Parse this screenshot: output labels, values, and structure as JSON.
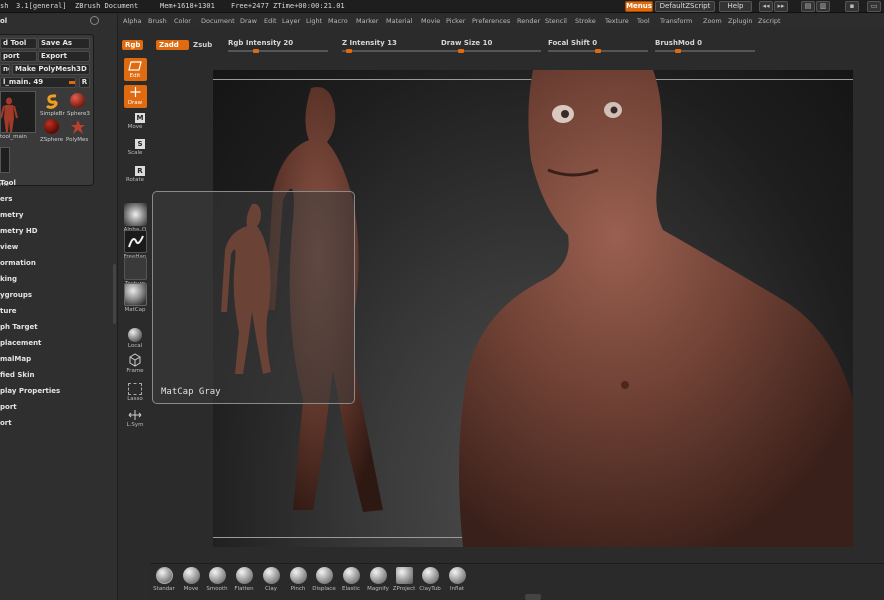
{
  "titlebar": {
    "app": "sh",
    "version": "3.1[general]",
    "document": "ZBrush Document",
    "mem": "Mem+1618+1301",
    "free": "Free+2477",
    "ztime": "ZTime+00:00:21.01",
    "menus_button": "Menus",
    "script_button": "DefaultZScript",
    "help_button": "Help"
  },
  "menubar": [
    "Alpha",
    "Brush",
    "Color",
    "Document",
    "Draw",
    "Edit",
    "Layer",
    "Light",
    "Macro",
    "Marker",
    "Material",
    "Movie",
    "Picker",
    "Preferences",
    "Render",
    "Stencil",
    "Stroke",
    "Texture",
    "Tool",
    "Transform",
    "Zoom",
    "Zplugin",
    "Zscript"
  ],
  "topshelf": {
    "rgb": "Rgb",
    "zadd": "Zadd",
    "zsub": "Zsub",
    "rgb_intensity": "Rgb Intensity 20",
    "z_intensity": "Z Intensity 13",
    "draw_size": "Draw Size 10",
    "focal_shift": "Focal Shift 0",
    "brush_mod": "BrushMod 0"
  },
  "leftpanel": {
    "title": "ol",
    "load_tool": "d Tool",
    "save_as": "Save As",
    "import": "port",
    "export": "Export",
    "clone": "ne",
    "make_polymesh": "Make PolyMesh3D",
    "slider_label": "l_main. 49",
    "r_button": "R",
    "current_tool_label": "tool_main",
    "simple_brush_label": "SimpleBr",
    "sphere3d_label": "Sphere3",
    "zsphere_label": "ZSphere",
    "polymesh_label": "PolyMes",
    "extra_label": "me",
    "menu_items": [
      "Tool",
      "ers",
      "metry",
      "metry HD",
      "view",
      "ormation",
      "king",
      "ygroups",
      "ture",
      "ph Target",
      "placement",
      "malMap",
      "fied Skin",
      "play Properties",
      "port",
      "ort"
    ]
  },
  "toolstrip": [
    {
      "label": "Edit"
    },
    {
      "label": "Draw"
    },
    {
      "label": "Move",
      "key": "M"
    },
    {
      "label": "Scale",
      "key": "S"
    },
    {
      "label": "Rotate",
      "key": "R"
    },
    {
      "label": "Alpha_O"
    },
    {
      "label": "FreeHan"
    },
    {
      "label": "Texture"
    },
    {
      "label": "MatCap"
    },
    {
      "label": "Local"
    },
    {
      "label": "Frame"
    },
    {
      "label": "Lasso"
    },
    {
      "label": "L.Sym"
    }
  ],
  "matcap_popup": {
    "caption": "MatCap Gray"
  },
  "bottomshelf": [
    "Standar",
    "Move",
    "Smooth",
    "Flatten",
    "Clay",
    "Pinch",
    "Displace",
    "Elastic",
    "Magnify",
    "ZProject",
    "ClayTub",
    "Inflat"
  ],
  "colors": {
    "accent": "#e06a10",
    "background": "#2b2b2b",
    "skin": "#7a4a3e"
  }
}
